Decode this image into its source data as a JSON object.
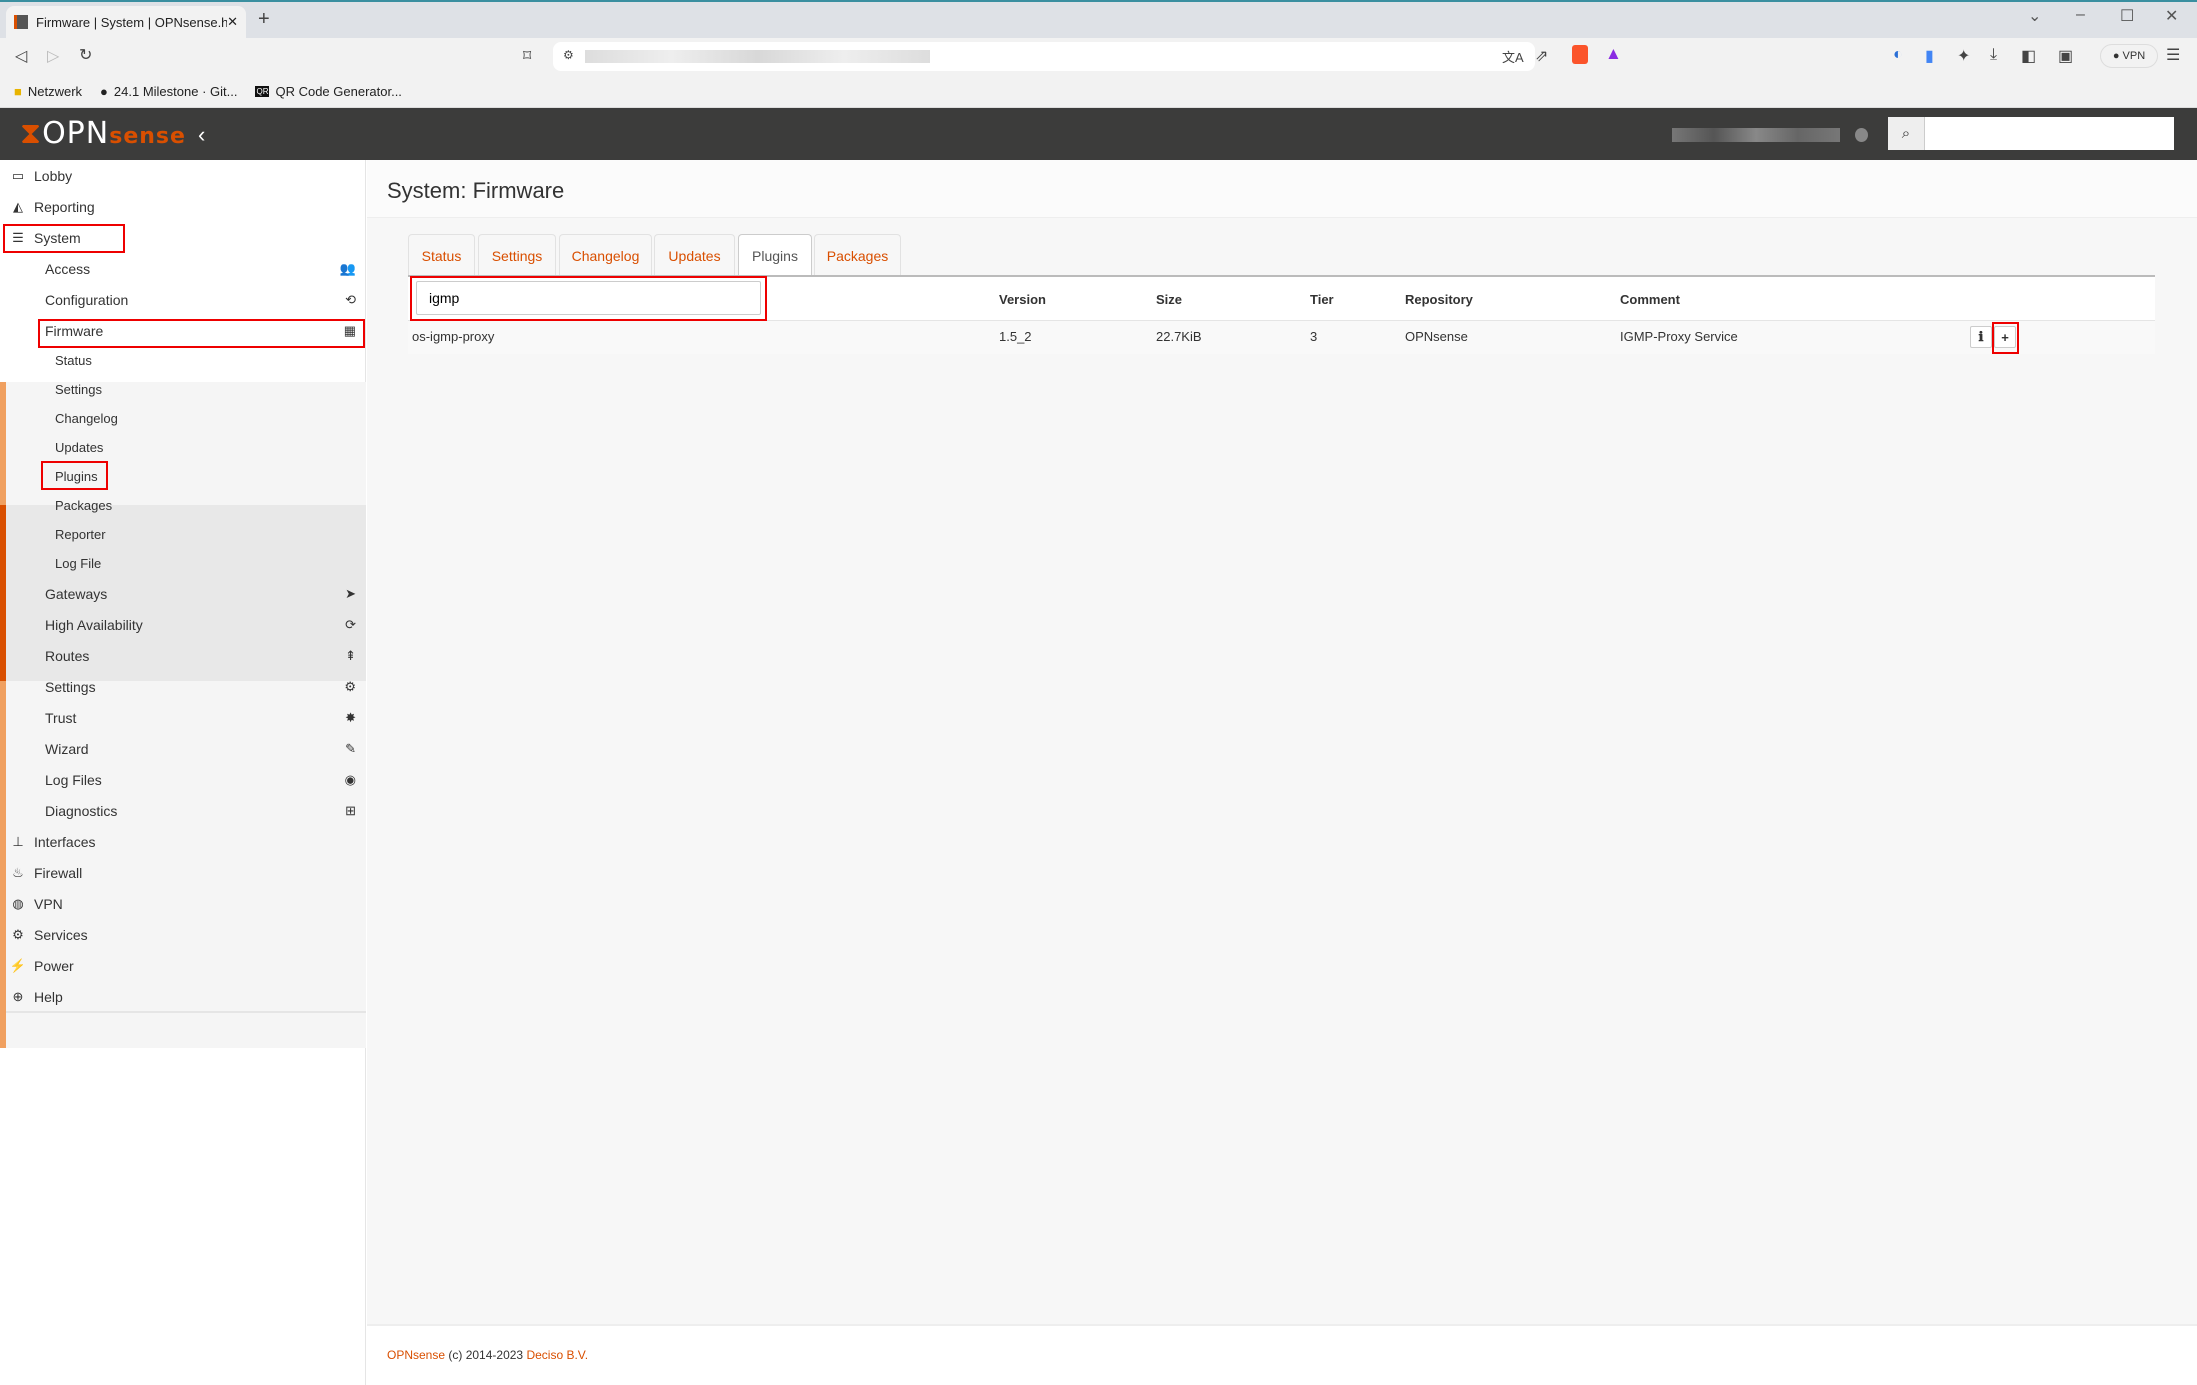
{
  "browser": {
    "tab_title": "Firmware | System | OPNsense.ho",
    "new_tab": "+",
    "vpn_label": "VPN",
    "bookmarks": [
      {
        "label": "Netzwerk",
        "icon": "folder-icon"
      },
      {
        "label": "24.1 Milestone · Git...",
        "icon": "github-icon"
      },
      {
        "label": "QR Code Generator...",
        "icon": "qr-icon"
      }
    ]
  },
  "header": {
    "logo": "OPNsense",
    "logo_main": "OPN",
    "logo_accent": "sense",
    "collapse": "‹"
  },
  "sidebar": {
    "top": [
      {
        "label": "Lobby",
        "icon": "laptop-icon",
        "glyph": "▭"
      },
      {
        "label": "Reporting",
        "icon": "area-chart-icon",
        "glyph": "◭"
      },
      {
        "label": "System",
        "icon": "server-icon",
        "glyph": "☰"
      }
    ],
    "system": [
      {
        "label": "Access",
        "icon": "users-icon",
        "glyph": "👥"
      },
      {
        "label": "Configuration",
        "icon": "history-icon",
        "glyph": "⟲"
      },
      {
        "label": "Firmware",
        "icon": "building-icon",
        "glyph": "▦"
      }
    ],
    "firmware": [
      "Status",
      "Settings",
      "Changelog",
      "Updates",
      "Plugins",
      "Packages",
      "Reporter",
      "Log File"
    ],
    "system2": [
      {
        "label": "Gateways",
        "icon": "location-arrow-icon",
        "glyph": "➤"
      },
      {
        "label": "High Availability",
        "icon": "refresh-icon",
        "glyph": "⟳"
      },
      {
        "label": "Routes",
        "icon": "signpost-icon",
        "glyph": "⇞"
      },
      {
        "label": "Settings",
        "icon": "cogs-icon",
        "glyph": "⚙"
      },
      {
        "label": "Trust",
        "icon": "certificate-icon",
        "glyph": "✸"
      },
      {
        "label": "Wizard",
        "icon": "magic-icon",
        "glyph": "✎"
      },
      {
        "label": "Log Files",
        "icon": "eye-icon",
        "glyph": "◉"
      },
      {
        "label": "Diagnostics",
        "icon": "medkit-icon",
        "glyph": "⊞"
      }
    ],
    "bottom": [
      {
        "label": "Interfaces",
        "icon": "sitemap-icon",
        "glyph": "⊥"
      },
      {
        "label": "Firewall",
        "icon": "fire-icon",
        "glyph": "♨"
      },
      {
        "label": "VPN",
        "icon": "globe-icon",
        "glyph": "◍"
      },
      {
        "label": "Services",
        "icon": "cog-icon",
        "glyph": "⚙"
      },
      {
        "label": "Power",
        "icon": "plug-icon",
        "glyph": "⚡"
      },
      {
        "label": "Help",
        "icon": "life-ring-icon",
        "glyph": "⊕"
      }
    ]
  },
  "page": {
    "title": "System: Firmware",
    "tabs": [
      "Status",
      "Settings",
      "Changelog",
      "Updates",
      "Plugins",
      "Packages"
    ],
    "active_tab": "Plugins",
    "search_value": "igmp",
    "columns": [
      "Version",
      "Size",
      "Tier",
      "Repository",
      "Comment"
    ],
    "rows": [
      {
        "name": "os-igmp-proxy",
        "version": "1.5_2",
        "size": "22.7KiB",
        "tier": "3",
        "repository": "OPNsense",
        "comment": "IGMP-Proxy Service"
      }
    ]
  },
  "footer": {
    "brand": "OPNsense",
    "copyright": "(c) 2014-2023",
    "company": "Deciso B.V."
  },
  "colors": {
    "accent": "#d94f00",
    "header": "#3c3c3b",
    "highlight": "#ee0000"
  }
}
